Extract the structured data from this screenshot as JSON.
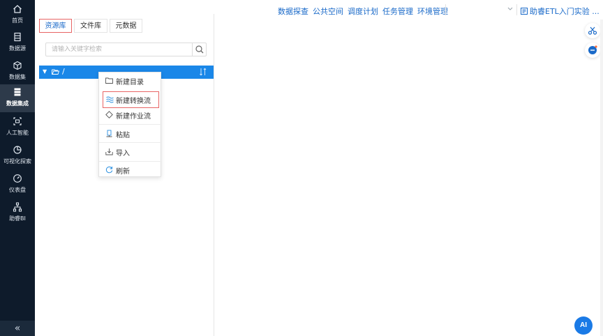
{
  "colors": {
    "sidebar_bg": "#0e1b2b",
    "accent": "#1a87e8",
    "link": "#1a6ac9",
    "highlight_border": "#e86464"
  },
  "sidebar": {
    "items": [
      {
        "label": "首页",
        "icon": "home-icon"
      },
      {
        "label": "数据源",
        "icon": "database-icon"
      },
      {
        "label": "数据集",
        "icon": "cube-icon"
      },
      {
        "label": "数据集成",
        "icon": "server-stack-icon",
        "active": true
      },
      {
        "label": "人工智能",
        "icon": "ai-chip-icon"
      },
      {
        "label": "可视化探索",
        "icon": "pie-chart-icon"
      },
      {
        "label": "仪表盘",
        "icon": "gauge-icon"
      },
      {
        "label": "助睿BI",
        "icon": "org-chart-icon"
      }
    ],
    "collapse_label": "«"
  },
  "topbar": {
    "nav": [
      "数据探查",
      "公共空间",
      "调度计划",
      "任务管理",
      "环境管理"
    ],
    "project": "助睿ETL入门实验 ..."
  },
  "tabs": [
    {
      "label": "资源库",
      "active": true
    },
    {
      "label": "文件库"
    },
    {
      "label": "元数据"
    }
  ],
  "search": {
    "placeholder": "请输入关键字检索",
    "value": ""
  },
  "tree": {
    "root_label": "/"
  },
  "context_menu": {
    "items": [
      {
        "label": "新建目录",
        "icon": "folder-icon"
      },
      {
        "label": "新建转换流",
        "icon": "transform-flow-icon",
        "highlighted": true
      },
      {
        "label": "新建作业流",
        "icon": "job-flow-icon"
      },
      {
        "label": "粘贴",
        "icon": "paste-icon"
      },
      {
        "label": "导入",
        "icon": "import-icon"
      },
      {
        "label": "刷新",
        "icon": "refresh-icon"
      }
    ]
  },
  "floating": {
    "ai_label": "AI"
  }
}
